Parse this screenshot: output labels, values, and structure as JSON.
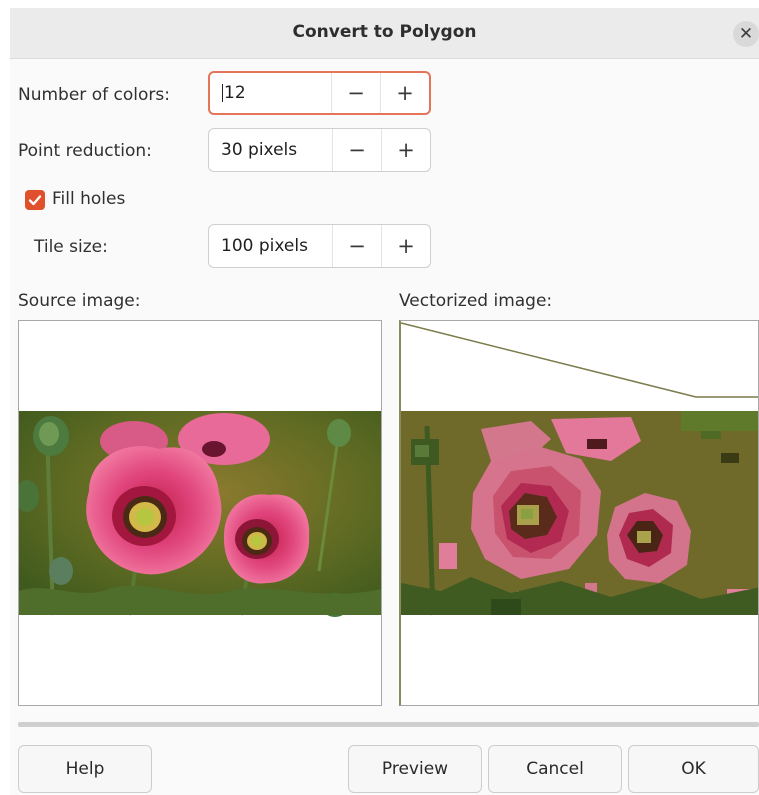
{
  "dialog": {
    "title": "Convert to Polygon",
    "close_icon": "✕"
  },
  "fields": {
    "colors": {
      "label": "Number of colors:",
      "value": "12"
    },
    "point_reduction": {
      "label": "Point reduction:",
      "value": "30 pixels"
    },
    "fill_holes": {
      "label": "Fill holes",
      "checked": true
    },
    "tile_size": {
      "label": "Tile size:",
      "value": "100 pixels"
    },
    "minus": "−",
    "plus": "+"
  },
  "previews": {
    "source_label": "Source image:",
    "vectorized_label": "Vectorized image:"
  },
  "buttons": {
    "help": "Help",
    "preview": "Preview",
    "cancel": "Cancel",
    "ok": "OK"
  },
  "colors": {
    "accent": "#e0502c",
    "focus_border": "#e4755a",
    "poppy_pink": "#e0457c",
    "background_green": "#6f6a2a"
  }
}
